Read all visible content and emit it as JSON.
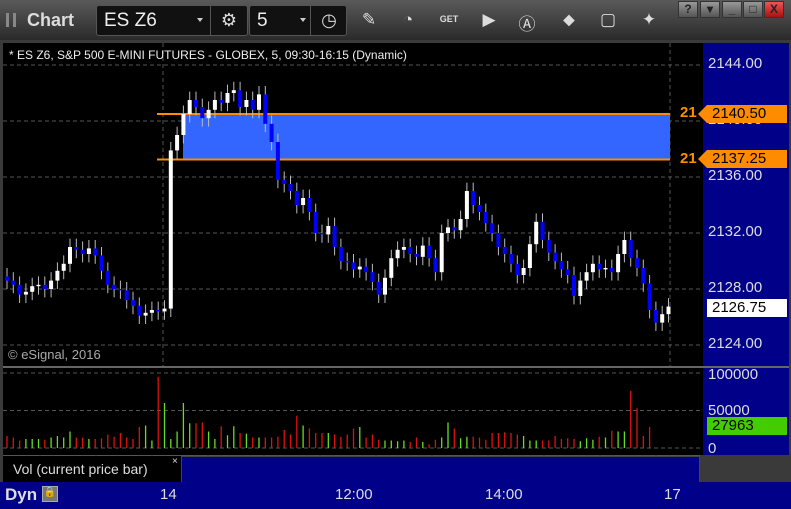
{
  "window": {
    "title": "Chart",
    "help": "?",
    "min": "_",
    "max": "□",
    "close": "X"
  },
  "toolbar": {
    "symbol": "ES Z6",
    "interval": "5",
    "icons": [
      "settings-icon",
      "clock-icon",
      "pencil-icon",
      "refresh-icon",
      "get-icon",
      "play-icon",
      "alert-icon",
      "link-icon",
      "comment-icon",
      "twitter-icon"
    ]
  },
  "chart": {
    "header": "* ES Z6, S&P 500 E-MINI FUTURES - GLOBEX, 5, 09:30-16:15 (Dynamic)",
    "copyright": "© eSignal, 2016",
    "price_labels": [
      "2144.00",
      "2140.00",
      "2136.00",
      "2132.00",
      "2128.00",
      "2124.00"
    ],
    "lines": [
      {
        "label": "21",
        "price": "2140.50"
      },
      {
        "label": "21",
        "price": "2137.25"
      }
    ],
    "last_price": "2126.75",
    "colors": {
      "up": "#ffffff",
      "down": "#0000ff",
      "zone": "#3366ff",
      "line": "#ff8c00",
      "vol_up": "#66dd22",
      "vol_down": "#dd1111"
    },
    "closes": [
      2128.6,
      2128.3,
      2127.6,
      2127.8,
      2128.2,
      2128.3,
      2128.0,
      2128.6,
      2129.3,
      2129.8,
      2131.0,
      2130.8,
      2130.5,
      2130.9,
      2130.4,
      2129.3,
      2128.3,
      2128.0,
      2127.9,
      2127.2,
      2126.8,
      2126.1,
      2126.3,
      2126.5,
      2126.4,
      2126.6,
      2137.9,
      2139.0,
      2140.5,
      2141.5,
      2141.0,
      2140.2,
      2140.8,
      2141.5,
      2141.3,
      2142.0,
      2142.2,
      2141.0,
      2141.5,
      2140.8,
      2141.9,
      2139.8,
      2138.5,
      2135.8,
      2135.5,
      2135.0,
      2134.0,
      2134.5,
      2133.5,
      2132.0,
      2131.9,
      2132.5,
      2131.0,
      2130.0,
      2129.9,
      2129.4,
      2129.6,
      2129.2,
      2128.5,
      2127.6,
      2128.8,
      2130.2,
      2130.8,
      2131.0,
      2130.5,
      2130.3,
      2131.1,
      2130.2,
      2129.2,
      2132.0,
      2132.4,
      2132.2,
      2133.0,
      2135.0,
      2134.0,
      2133.5,
      2132.7,
      2132.0,
      2131.0,
      2130.5,
      2129.8,
      2129.0,
      2129.5,
      2131.2,
      2132.8,
      2131.5,
      2130.6,
      2130.0,
      2129.4,
      2129.0,
      2127.5,
      2128.6,
      2129.2,
      2129.8,
      2129.4,
      2129.5,
      2129.2,
      2130.5,
      2131.5,
      2130.2,
      2129.5,
      2128.4,
      2126.5,
      2125.6,
      2126.2,
      2126.75
    ]
  },
  "volume": {
    "label": "Vol (current price bar)",
    "close": "×",
    "axis_labels": [
      "100000",
      "50000",
      "0"
    ],
    "last": "27963",
    "values": [
      16000,
      14000,
      10000,
      12000,
      12000,
      12000,
      11000,
      14000,
      16000,
      14000,
      22000,
      14000,
      14000,
      12000,
      12000,
      13000,
      18000,
      15000,
      20000,
      14000,
      12000,
      28000,
      30000,
      10000,
      95000,
      60000,
      12000,
      22000,
      60000,
      33000,
      33000,
      34000,
      22000,
      12000,
      29000,
      17000,
      29000,
      20000,
      19000,
      14000,
      14000,
      14000,
      14000,
      15000,
      24000,
      18000,
      43000,
      30000,
      26000,
      20000,
      20000,
      20000,
      18000,
      15000,
      18000,
      26000,
      28000,
      14000,
      18000,
      11000,
      10000,
      10000,
      9000,
      10000,
      8000,
      14000,
      8000,
      5000,
      11000,
      14000,
      34000,
      26000,
      13000,
      15000,
      15000,
      14000,
      11000,
      20000,
      20000,
      21000,
      20000,
      18000,
      16000,
      10000,
      10000,
      10000,
      10000,
      16000,
      12000,
      13000,
      12000,
      9000,
      13000,
      11000,
      15000,
      14000,
      23000,
      22000,
      22000,
      76000,
      53000,
      16000,
      27963
    ]
  },
  "time_axis": {
    "mode": "Dyn",
    "labels": [
      "14",
      "12:00",
      "14:00",
      "17"
    ]
  }
}
